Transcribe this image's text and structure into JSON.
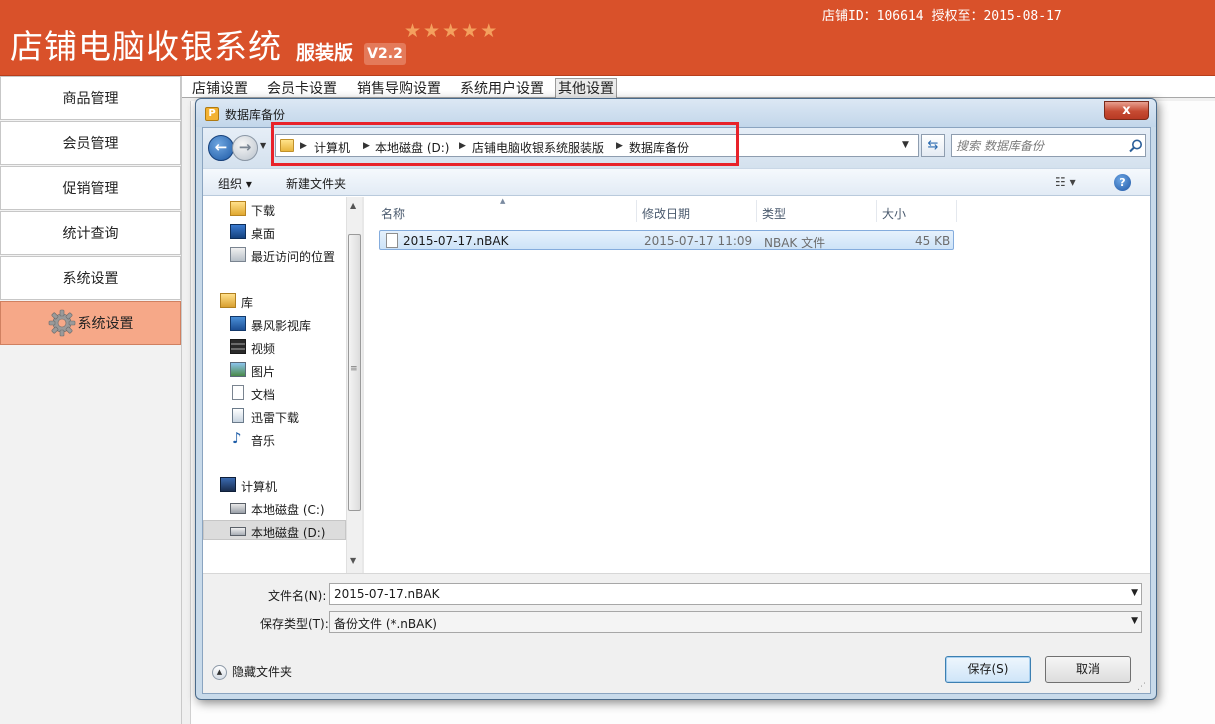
{
  "header": {
    "title": "店铺电脑收银系统",
    "edition": "服装版",
    "version": "V2.2",
    "stars": [
      "★",
      "★",
      "★",
      "★",
      "★"
    ],
    "store_info": "店铺ID：106614 授权至：2015-08-17",
    "bg_color": "#d9512a"
  },
  "sidebar": {
    "items": [
      {
        "label": "商品管理"
      },
      {
        "label": "会员管理"
      },
      {
        "label": "促销管理"
      },
      {
        "label": "统计查询"
      },
      {
        "label": "系统设置"
      },
      {
        "label": "系统设置",
        "active": true,
        "icon": "gear-icon"
      }
    ],
    "active_color": "#f6a888"
  },
  "tabs": [
    {
      "label": "店铺设置"
    },
    {
      "label": "会员卡设置"
    },
    {
      "label": "销售导购设置"
    },
    {
      "label": "系统用户设置"
    },
    {
      "label": "其他设置",
      "active": true
    }
  ],
  "dialog": {
    "title": "数据库备份",
    "close_label": "x",
    "address": {
      "crumbs": [
        "计算机",
        "本地磁盘 (D:)",
        "店铺电脑收银系统服装版",
        "数据库备份"
      ],
      "highlight_color": "#e8222a"
    },
    "search": {
      "placeholder": "搜索 数据库备份"
    },
    "toolbar": {
      "organize": "组织 ▾",
      "new_folder": "新建文件夹",
      "views": "☷ ▾",
      "help": "?"
    },
    "nav_pane": {
      "items": [
        {
          "label": "下载",
          "icon": "download-folder-icon"
        },
        {
          "label": "桌面",
          "icon": "desktop-icon"
        },
        {
          "label": "最近访问的位置",
          "icon": "recent-places-icon"
        },
        {
          "label": "库",
          "icon": "library-icon"
        },
        {
          "label": "暴风影视库",
          "icon": "video-library-icon"
        },
        {
          "label": "视频",
          "icon": "video-icon"
        },
        {
          "label": "图片",
          "icon": "picture-icon"
        },
        {
          "label": "文档",
          "icon": "document-icon"
        },
        {
          "label": "迅雷下载",
          "icon": "thunder-download-icon"
        },
        {
          "label": "音乐",
          "icon": "music-icon"
        },
        {
          "label": "计算机",
          "icon": "computer-icon"
        },
        {
          "label": "本地磁盘 (C:)",
          "icon": "drive-c-icon"
        },
        {
          "label": "本地磁盘 (D:)",
          "icon": "drive-d-icon",
          "selected": true
        }
      ]
    },
    "file_list": {
      "columns": [
        "名称",
        "修改日期",
        "类型",
        "大小"
      ],
      "rows": [
        {
          "name": "2015-07-17.nBAK",
          "date": "2015-07-17 11:09",
          "type": "NBAK 文件",
          "size": "45 KB"
        }
      ]
    },
    "form": {
      "filename_label": "文件名(N):",
      "filename_value": "2015-07-17.nBAK",
      "filetype_label": "保存类型(T):",
      "filetype_value": "备份文件 (*.nBAK)",
      "hide_folders": "隐藏文件夹",
      "save": "保存(S)",
      "cancel": "取消"
    }
  }
}
